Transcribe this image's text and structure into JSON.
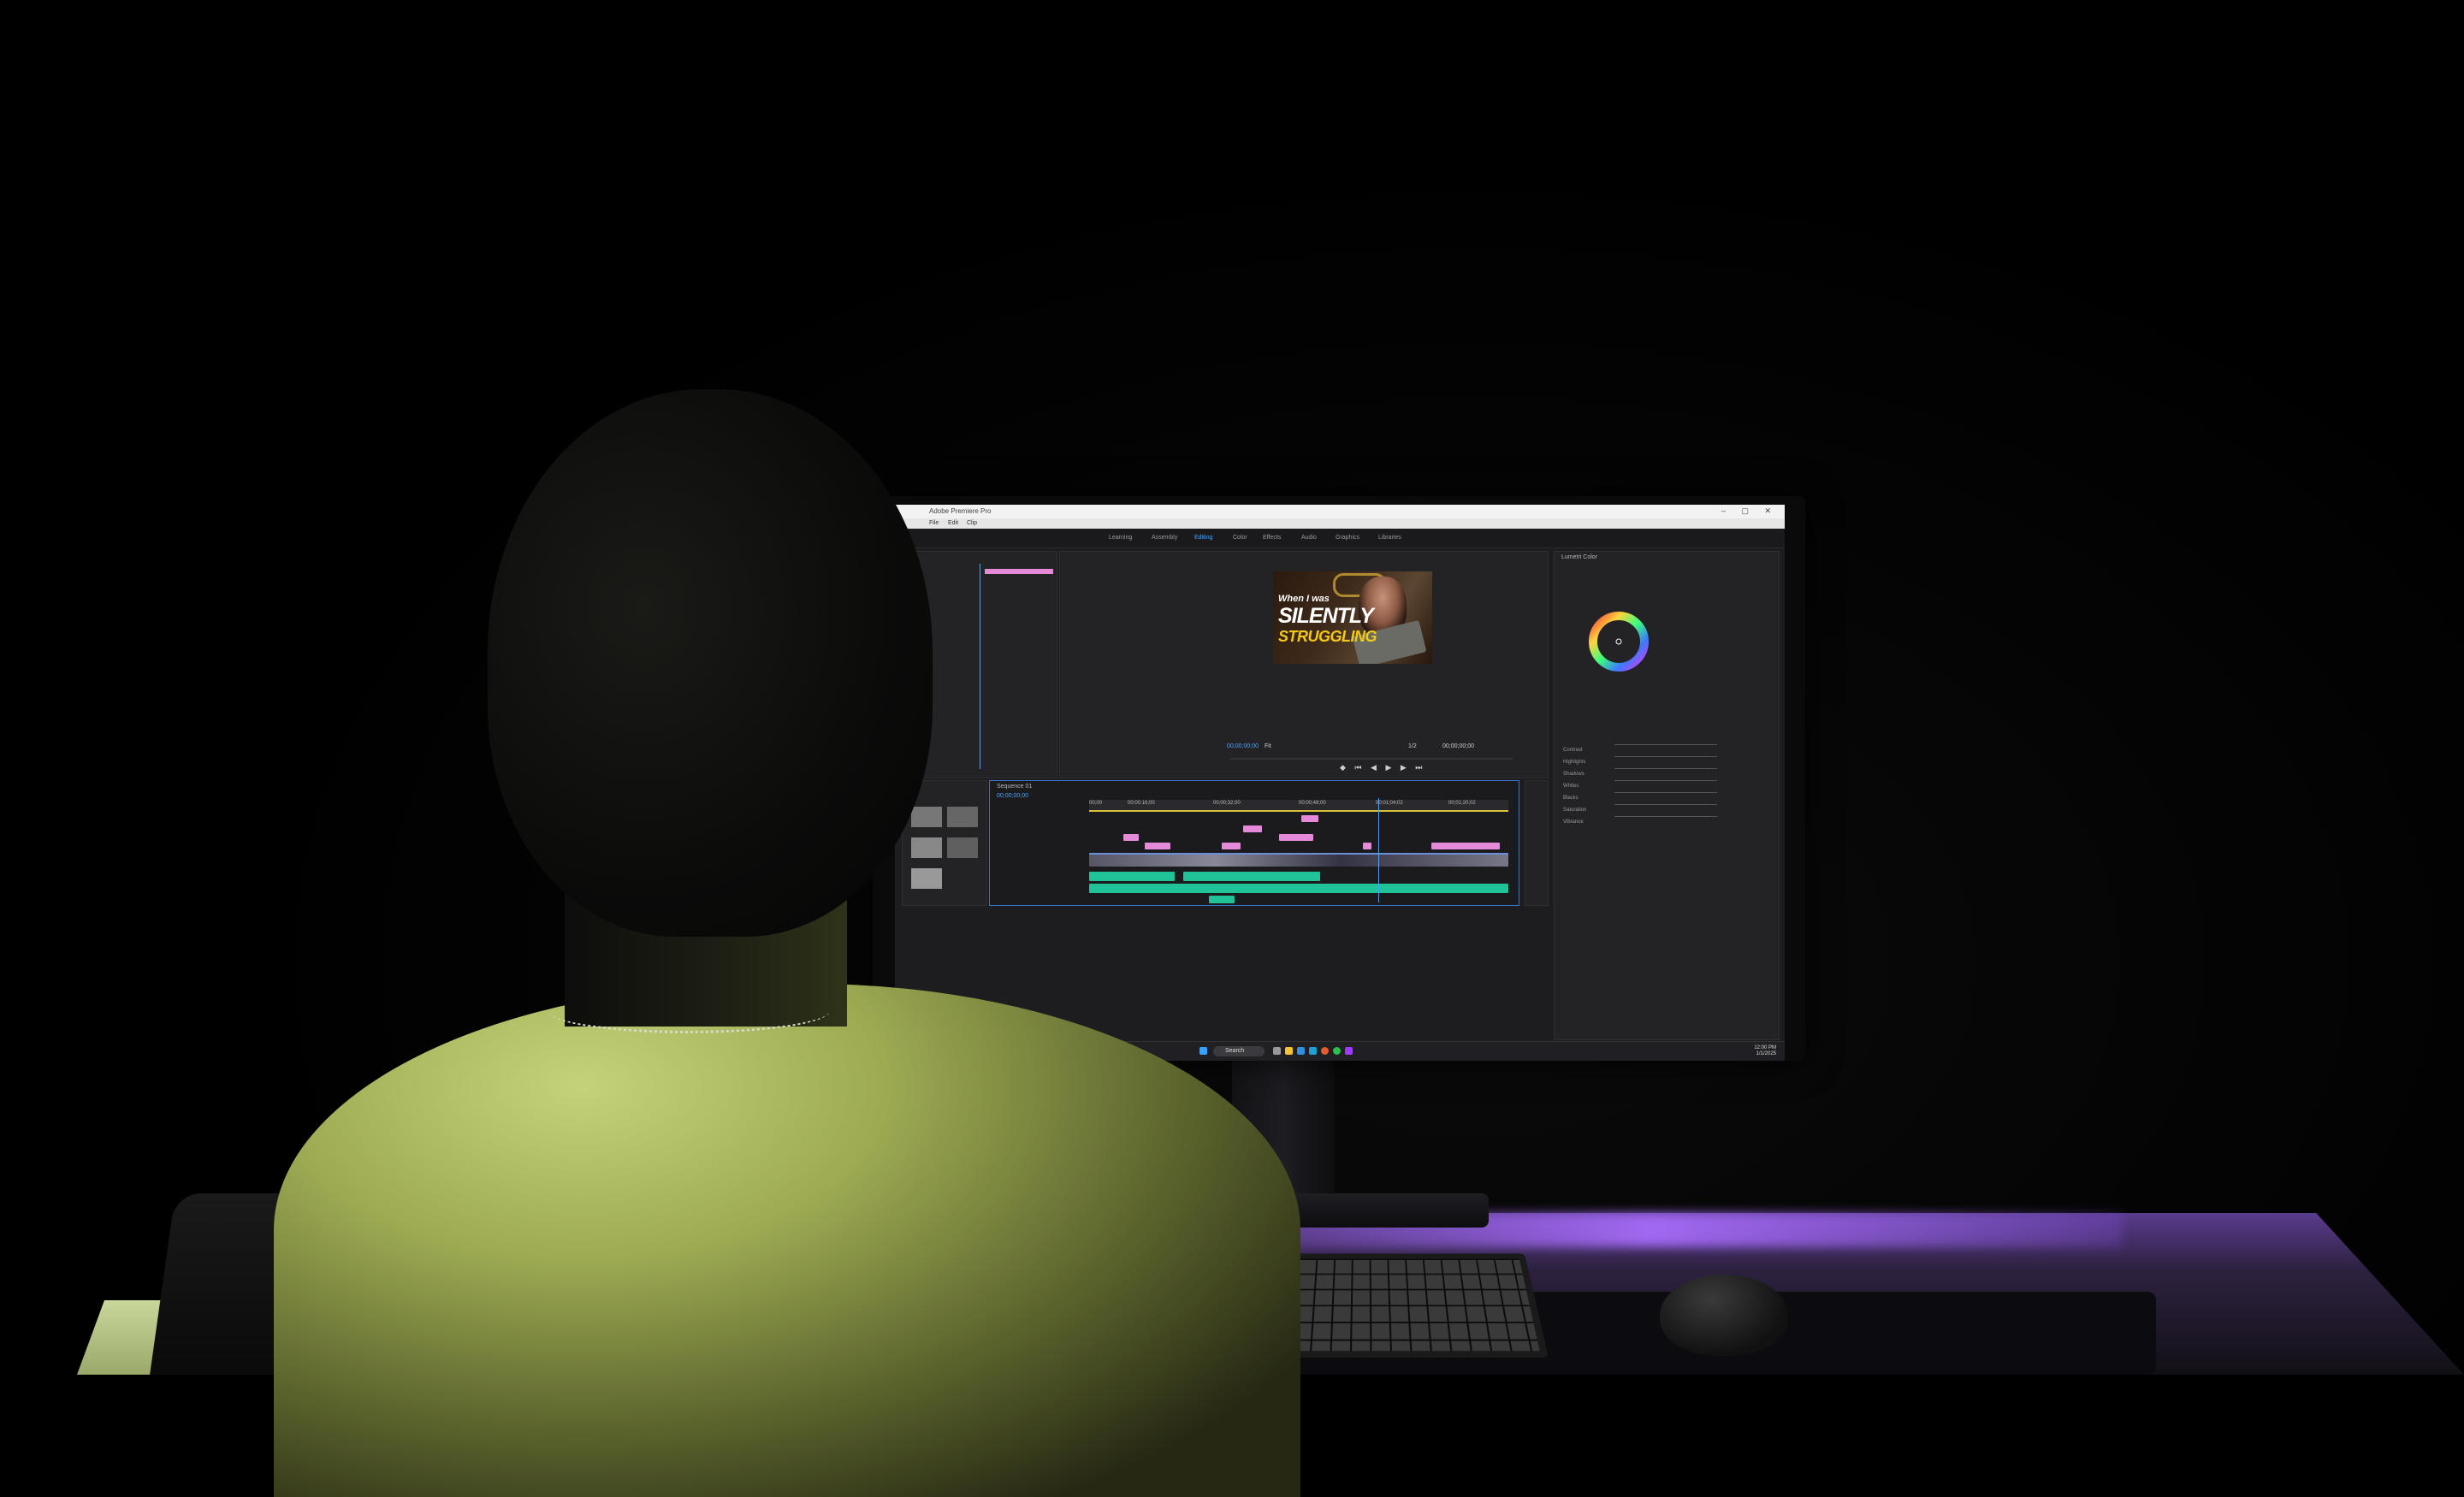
{
  "app": {
    "title": "Adobe Premiere Pro",
    "menus": [
      "File",
      "Edit",
      "Clip"
    ],
    "workspaces": [
      "Learning",
      "Assembly",
      "Editing",
      "Color",
      "Effects",
      "Audio",
      "Graphics",
      "Libraries"
    ],
    "active_workspace": "Editing"
  },
  "video_overlay": {
    "line1": "When I was",
    "line2": "SILENTLY",
    "line3": "STRUGGLING"
  },
  "program_monitor": {
    "timecode_left": "00;00;00;00",
    "timecode_right": "00;00;00;00",
    "fit_label": "Fit",
    "fraction_label": "1/2"
  },
  "timeline": {
    "sequence_name": "Sequence 01",
    "timecode": "00;00;00;00",
    "ruler_labels": [
      "00;00",
      "00;00;16;00",
      "00;00;32;00",
      "00;00;48;00",
      "00;01;04;02",
      "00;01;20;02"
    ],
    "playhead_fraction": 0.69
  },
  "lumetri": {
    "title": "Lumetri Color",
    "sliders": [
      "Contrast",
      "Highlights",
      "Shadows",
      "Whites",
      "Blacks",
      "Saturation",
      "Vibrance"
    ]
  },
  "taskbar": {
    "search_label": "Search",
    "time": "12:00 PM",
    "date": "1/1/2025"
  },
  "colors": {
    "accent": "#4aa3ff",
    "clip_pink": "#e58ad8",
    "clip_teal": "#20c297",
    "desk_glow": "#a96eff",
    "shirt": "#b7c66b"
  }
}
